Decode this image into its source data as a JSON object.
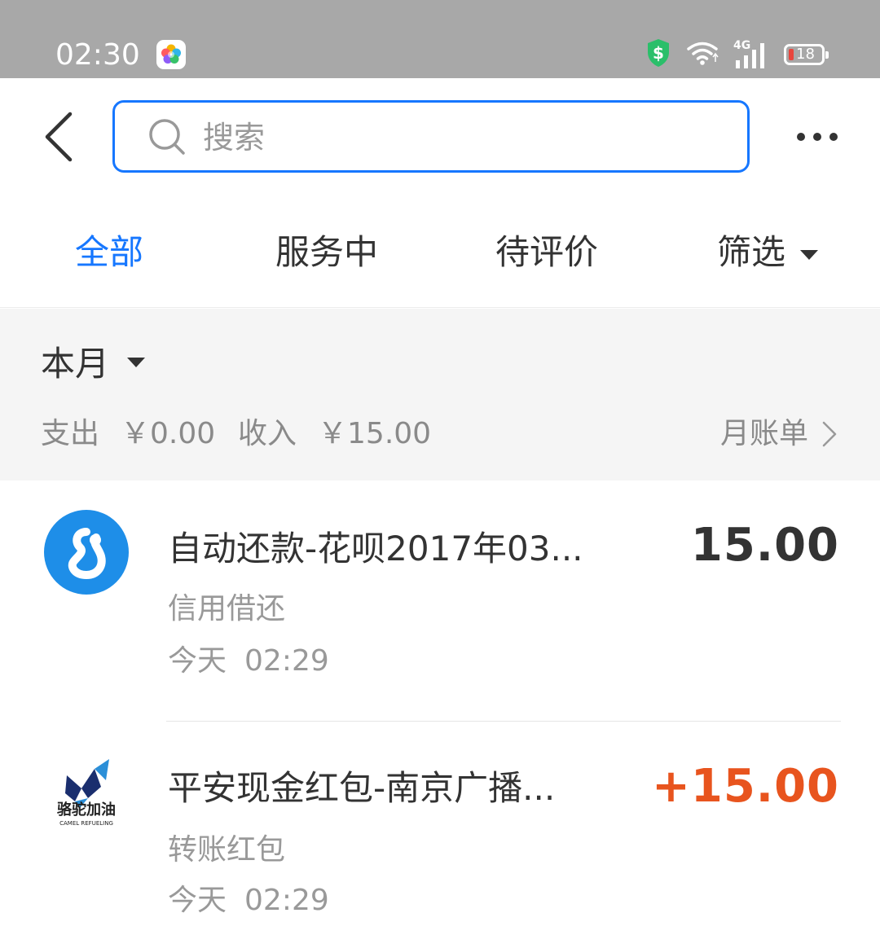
{
  "status_bar": {
    "time": "02:30",
    "network": "4G",
    "battery_level": "18",
    "icons": [
      "app-icon",
      "shield-dollar-icon",
      "wifi-icon",
      "signal-icon",
      "battery-icon"
    ]
  },
  "search": {
    "placeholder": "搜索"
  },
  "tabs": [
    {
      "label": "全部",
      "active": true
    },
    {
      "label": "服务中",
      "active": false
    },
    {
      "label": "待评价",
      "active": false
    },
    {
      "label": "筛选",
      "active": false
    }
  ],
  "summary": {
    "month": "本月",
    "expense_label": "支出",
    "expense_amount": "￥0.00",
    "income_label": "收入",
    "income_amount": "￥15.00",
    "monthly_bill": "月账单"
  },
  "transactions": [
    {
      "title": "自动还款-花呗2017年03...",
      "category": "信用借还",
      "date": "今天",
      "time": "02:29",
      "amount": "15.00",
      "amount_color": "#333333",
      "icon": "huabei-icon"
    },
    {
      "title": "平安现金红包-南京广播...",
      "category": "转账红包",
      "date": "今天",
      "time": "02:29",
      "amount": "+15.00",
      "amount_color": "#e8541e",
      "icon": "camel-refueling-logo",
      "logo_text": "骆驼加油",
      "logo_subtext": "CAMEL REFUELING"
    }
  ],
  "colors": {
    "accent": "#1677ff",
    "status_bar": "#a8a8a8",
    "income": "#e8541e",
    "muted_text": "#999999"
  }
}
